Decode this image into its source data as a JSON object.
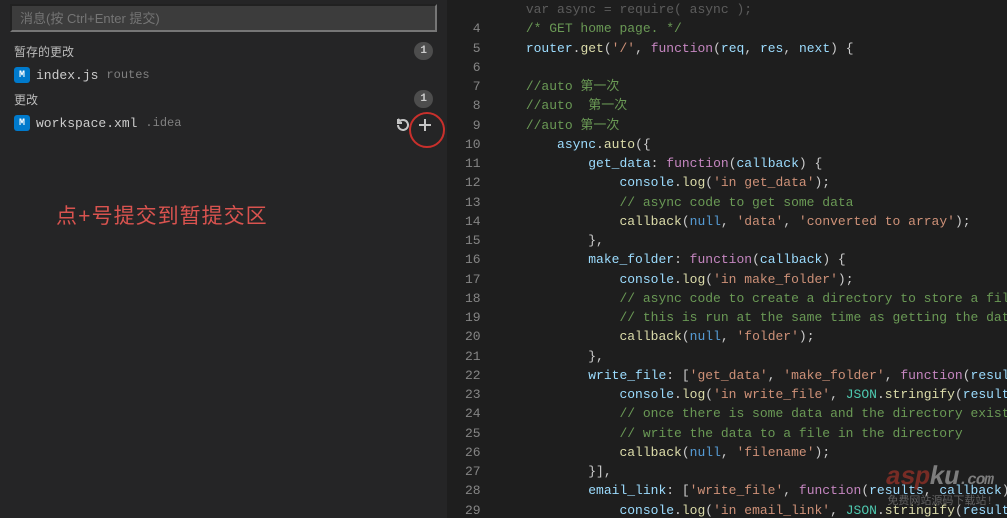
{
  "messageBox": {
    "placeholder": "消息(按 Ctrl+Enter 提交)"
  },
  "sections": {
    "staged": {
      "title": "暂存的更改",
      "count": "1"
    },
    "changes": {
      "title": "更改",
      "count": "1"
    }
  },
  "files": {
    "staged": [
      {
        "status": "M",
        "name": "index.js",
        "dir": "routes"
      }
    ],
    "changes": [
      {
        "status": "M",
        "name": "workspace.xml",
        "dir": ".idea"
      }
    ]
  },
  "annotation": "点+号提交到暂提交区",
  "rowActions": {
    "discard": "discard",
    "stage": "stage"
  },
  "gutter": [
    "",
    "4",
    "5",
    "6",
    "7",
    "8",
    "9",
    "10",
    "11",
    "12",
    "13",
    "14",
    "15",
    "16",
    "17",
    "18",
    "19",
    "20",
    "21",
    "22",
    "23",
    "24",
    "25",
    "26",
    "27",
    "28",
    "29"
  ],
  "code": [
    {
      "segs": [
        [
          "    ",
          "pn"
        ],
        [
          "var async = require( async );",
          "pn-faded"
        ]
      ]
    },
    {
      "segs": [
        [
          "    ",
          "pn"
        ],
        [
          "/* GET home page. */",
          "cm"
        ]
      ]
    },
    {
      "segs": [
        [
          "    ",
          "pn"
        ],
        [
          "router",
          "vr"
        ],
        [
          ".",
          "pn"
        ],
        [
          "get",
          "fn"
        ],
        [
          "(",
          "pn"
        ],
        [
          "'/'",
          "st"
        ],
        [
          ", ",
          "pn"
        ],
        [
          "function",
          "kw"
        ],
        [
          "(",
          "pn"
        ],
        [
          "req",
          "vr"
        ],
        [
          ", ",
          "pn"
        ],
        [
          "res",
          "vr"
        ],
        [
          ", ",
          "pn"
        ],
        [
          "next",
          "vr"
        ],
        [
          ") {",
          "pn"
        ]
      ]
    },
    {
      "segs": [
        [
          "",
          "pn"
        ]
      ]
    },
    {
      "segs": [
        [
          "    ",
          "pn"
        ],
        [
          "//auto 第一次",
          "cm"
        ]
      ]
    },
    {
      "segs": [
        [
          "    ",
          "pn"
        ],
        [
          "//auto  第一次",
          "cm"
        ]
      ]
    },
    {
      "segs": [
        [
          "    ",
          "pn"
        ],
        [
          "//auto 第一次",
          "cm"
        ]
      ]
    },
    {
      "segs": [
        [
          "        ",
          "pn"
        ],
        [
          "async",
          "vr"
        ],
        [
          ".",
          "pn"
        ],
        [
          "auto",
          "fn"
        ],
        [
          "({",
          "pn"
        ]
      ]
    },
    {
      "segs": [
        [
          "            ",
          "pn"
        ],
        [
          "get_data",
          "vr"
        ],
        [
          ": ",
          "pn"
        ],
        [
          "function",
          "kw"
        ],
        [
          "(",
          "pn"
        ],
        [
          "callback",
          "vr"
        ],
        [
          ") {",
          "pn"
        ]
      ]
    },
    {
      "segs": [
        [
          "                ",
          "pn"
        ],
        [
          "console",
          "vr"
        ],
        [
          ".",
          "pn"
        ],
        [
          "log",
          "fn"
        ],
        [
          "(",
          "pn"
        ],
        [
          "'in get_data'",
          "st"
        ],
        [
          ");",
          "pn"
        ]
      ]
    },
    {
      "segs": [
        [
          "                ",
          "pn"
        ],
        [
          "// async code to get some data",
          "cm"
        ]
      ]
    },
    {
      "segs": [
        [
          "                ",
          "pn"
        ],
        [
          "callback",
          "fn"
        ],
        [
          "(",
          "pn"
        ],
        [
          "null",
          "nl"
        ],
        [
          ", ",
          "pn"
        ],
        [
          "'data'",
          "st"
        ],
        [
          ", ",
          "pn"
        ],
        [
          "'converted to array'",
          "st"
        ],
        [
          ");",
          "pn"
        ]
      ]
    },
    {
      "segs": [
        [
          "            },",
          "pn"
        ]
      ]
    },
    {
      "segs": [
        [
          "            ",
          "pn"
        ],
        [
          "make_folder",
          "vr"
        ],
        [
          ": ",
          "pn"
        ],
        [
          "function",
          "kw"
        ],
        [
          "(",
          "pn"
        ],
        [
          "callback",
          "vr"
        ],
        [
          ") {",
          "pn"
        ]
      ]
    },
    {
      "segs": [
        [
          "                ",
          "pn"
        ],
        [
          "console",
          "vr"
        ],
        [
          ".",
          "pn"
        ],
        [
          "log",
          "fn"
        ],
        [
          "(",
          "pn"
        ],
        [
          "'in make_folder'",
          "st"
        ],
        [
          ");",
          "pn"
        ]
      ]
    },
    {
      "segs": [
        [
          "                ",
          "pn"
        ],
        [
          "// async code to create a directory to store a file in",
          "cm"
        ]
      ]
    },
    {
      "segs": [
        [
          "                ",
          "pn"
        ],
        [
          "// this is run at the same time as getting the data",
          "cm"
        ]
      ]
    },
    {
      "segs": [
        [
          "                ",
          "pn"
        ],
        [
          "callback",
          "fn"
        ],
        [
          "(",
          "pn"
        ],
        [
          "null",
          "nl"
        ],
        [
          ", ",
          "pn"
        ],
        [
          "'folder'",
          "st"
        ],
        [
          ");",
          "pn"
        ]
      ]
    },
    {
      "segs": [
        [
          "            },",
          "pn"
        ]
      ]
    },
    {
      "segs": [
        [
          "            ",
          "pn"
        ],
        [
          "write_file",
          "vr"
        ],
        [
          ": [",
          "pn"
        ],
        [
          "'get_data'",
          "st"
        ],
        [
          ", ",
          "pn"
        ],
        [
          "'make_folder'",
          "st"
        ],
        [
          ", ",
          "pn"
        ],
        [
          "function",
          "kw"
        ],
        [
          "(",
          "pn"
        ],
        [
          "results",
          "vr"
        ],
        [
          ", ",
          "pn"
        ]
      ]
    },
    {
      "segs": [
        [
          "                ",
          "pn"
        ],
        [
          "console",
          "vr"
        ],
        [
          ".",
          "pn"
        ],
        [
          "log",
          "fn"
        ],
        [
          "(",
          "pn"
        ],
        [
          "'in write_file'",
          "st"
        ],
        [
          ", ",
          "pn"
        ],
        [
          "JSON",
          "mt"
        ],
        [
          ".",
          "pn"
        ],
        [
          "stringify",
          "fn"
        ],
        [
          "(",
          "pn"
        ],
        [
          "results",
          "vr"
        ],
        [
          "));",
          "pn"
        ]
      ]
    },
    {
      "segs": [
        [
          "                ",
          "pn"
        ],
        [
          "// once there is some data and the directory exists,",
          "cm"
        ]
      ]
    },
    {
      "segs": [
        [
          "                ",
          "pn"
        ],
        [
          "// write the data to a file in the directory",
          "cm"
        ]
      ]
    },
    {
      "segs": [
        [
          "                ",
          "pn"
        ],
        [
          "callback",
          "fn"
        ],
        [
          "(",
          "pn"
        ],
        [
          "null",
          "nl"
        ],
        [
          ", ",
          "pn"
        ],
        [
          "'filename'",
          "st"
        ],
        [
          ");",
          "pn"
        ]
      ]
    },
    {
      "segs": [
        [
          "            }],",
          "pn"
        ]
      ]
    },
    {
      "segs": [
        [
          "            ",
          "pn"
        ],
        [
          "email_link",
          "vr"
        ],
        [
          ": [",
          "pn"
        ],
        [
          "'write_file'",
          "st"
        ],
        [
          ", ",
          "pn"
        ],
        [
          "function",
          "kw"
        ],
        [
          "(",
          "pn"
        ],
        [
          "results",
          "vr"
        ],
        [
          ", ",
          "pn"
        ],
        [
          "callback",
          "vr"
        ],
        [
          ") {",
          "pn"
        ]
      ]
    },
    {
      "segs": [
        [
          "                ",
          "pn"
        ],
        [
          "console",
          "vr"
        ],
        [
          ".",
          "pn"
        ],
        [
          "log",
          "fn"
        ],
        [
          "(",
          "pn"
        ],
        [
          "'in email_link'",
          "st"
        ],
        [
          ", ",
          "pn"
        ],
        [
          "JSON",
          "mt"
        ],
        [
          ".",
          "pn"
        ],
        [
          "stringify",
          "fn"
        ],
        [
          "(",
          "pn"
        ],
        [
          "results",
          "vr"
        ],
        [
          "));",
          "pn"
        ]
      ]
    }
  ],
  "watermark": {
    "brand_a": "asp",
    "brand_k": "ku",
    "brand_c": ".com",
    "sub": "免费网站源码下载站!"
  }
}
